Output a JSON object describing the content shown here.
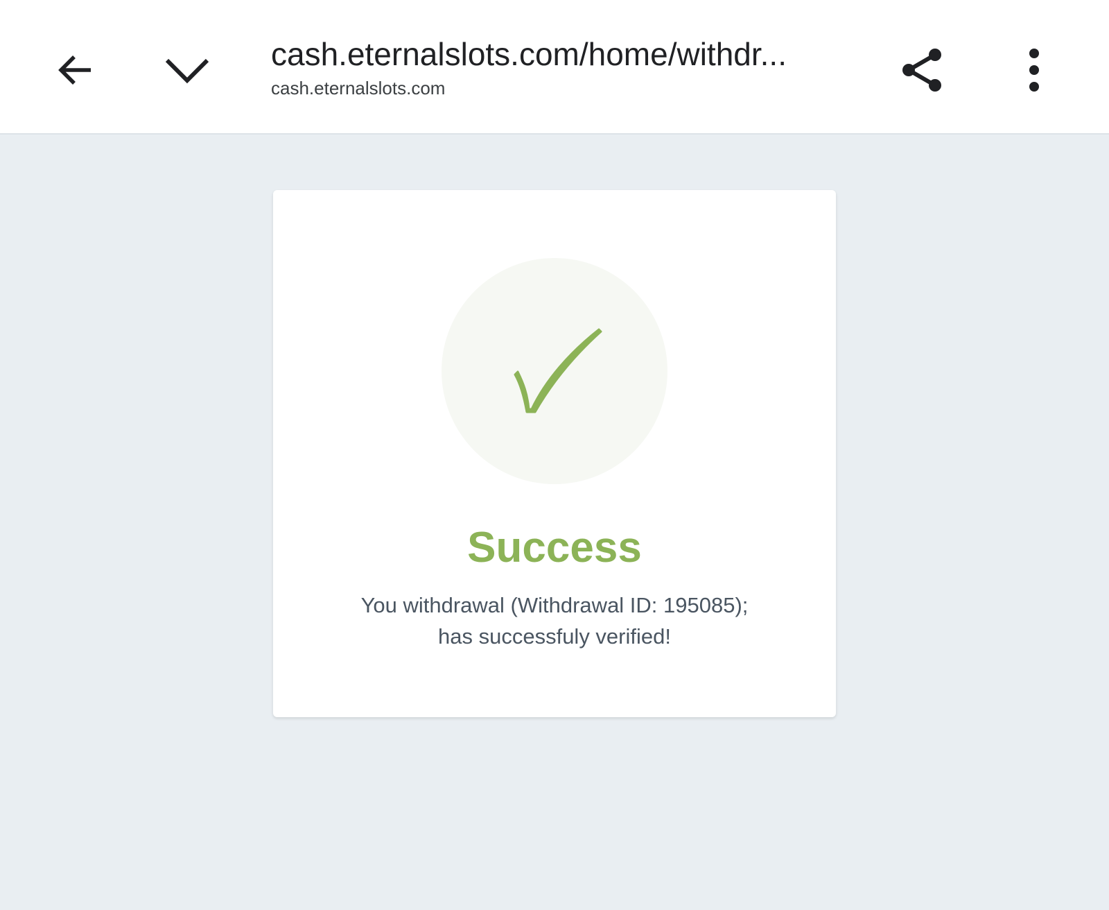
{
  "browser": {
    "url_title": "cash.eternalslots.com/home/withdr...",
    "url_domain": "cash.eternalslots.com",
    "icons": {
      "back": "arrow-left-icon",
      "collapse": "chevron-down-icon",
      "share": "share-icon",
      "menu": "more-vertical-icon"
    }
  },
  "result": {
    "icon": "checkmark-icon",
    "title": "Success",
    "message_line1": "You withdrawal (Withdrawal ID: 195085);",
    "message_line2": "has successfuly verified!"
  },
  "colors": {
    "accent": "#8cb357",
    "page_background": "#e9eef2",
    "check_circle": "#f6f8f3",
    "message_text": "#4a5561"
  }
}
